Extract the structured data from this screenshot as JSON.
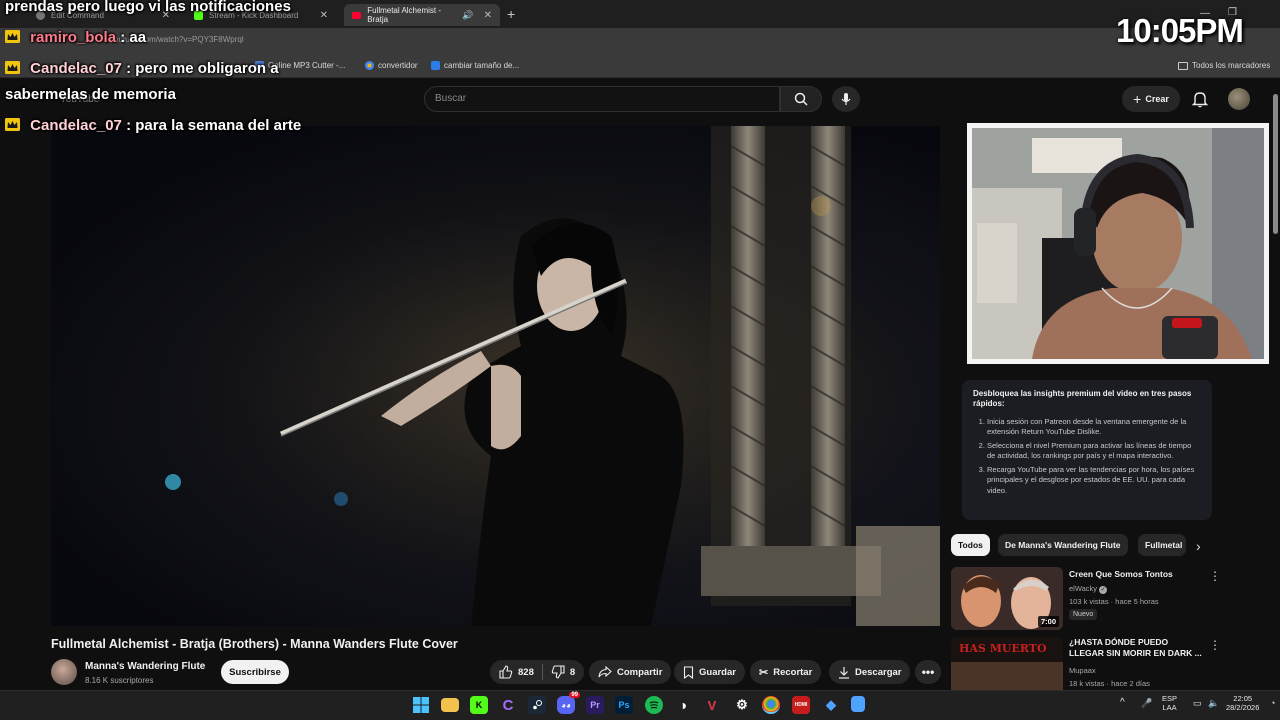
{
  "browser": {
    "tabs": [
      {
        "label": "Edit Command",
        "active": false
      },
      {
        "label": "Stream - Kick Dashboard",
        "active": false
      },
      {
        "label": "Fullmetal Alchemist - Bratja",
        "active": true
      }
    ],
    "new_tab": "+",
    "url": "youtube.com/watch?v=PQY3F8Wprql",
    "bookmarks": [
      "Online MP3 Cutter -...",
      "convertidor",
      "cambiar tamaño de..."
    ],
    "all_bookmarks": "Todos los marcadores"
  },
  "youtube": {
    "logo_text": "YouTube",
    "search_placeholder": "Buscar",
    "create_label": "Crear",
    "video": {
      "title": "Fullmetal Alchemist - Bratja (Brothers) - Manna Wanders Flute Cover",
      "channel": "Manna's Wandering Flute",
      "subscribers": "8.16 K suscriptores",
      "subscribe_label": "Suscribirse",
      "likes": "828",
      "dislikes": "8",
      "share_label": "Compartir",
      "save_label": "Guardar",
      "clip_label": "Recortar",
      "download_label": "Descargar"
    },
    "insights": {
      "title": "Desbloquea las insights premium del video en tres pasos rápidos:",
      "steps": [
        "Inicia sesión con Patreon desde la ventana emergente de la extensión Return YouTube Dislike.",
        "Selecciona el nivel Premium para activar las líneas de tiempo de actividad, los rankings por país y el mapa interactivo.",
        "Recarga YouTube para ver las tendencias por hora, los países principales y el desglose por estados de EE. UU. para cada video."
      ]
    },
    "chips": [
      "Todos",
      "De Manna's Wandering Flute",
      "Fullmetal"
    ],
    "recommendations": [
      {
        "title": "Creen Que Somos Tontos",
        "channel": "elWacky",
        "meta": "103 k vistas · hace 5 horas",
        "badge": "Nuevo",
        "duration": "7:00"
      },
      {
        "title": "¿HASTA DÓNDE PUEDO LLEGAR SIN MORIR EN DARK ...",
        "channel": "Mupaax",
        "meta": "18 k vistas · hace 2 días",
        "thumb_text": "HAS MUERTO"
      }
    ]
  },
  "overlay": {
    "chat": [
      {
        "user": "",
        "text": "prendas pero luego vi las notificaciones"
      },
      {
        "user": "ramiro_bola",
        "text": ": aa"
      },
      {
        "user": "Candelac_07",
        "text": ": pero me obligaron a"
      },
      {
        "user": "",
        "text": "sabermelas de memoria"
      },
      {
        "user": "Candelac_07",
        "text": ": para la semana del arte"
      }
    ],
    "clock": "10:05PM"
  },
  "taskbar": {
    "lang": "ESP",
    "lang2": "LAA",
    "time": "22:05",
    "date": "28/2/2026",
    "discord_badge": "99"
  },
  "colors": {
    "yt_red": "#ff0033",
    "chat_user": "#ff7a8a",
    "background": "#0f0f0f"
  }
}
